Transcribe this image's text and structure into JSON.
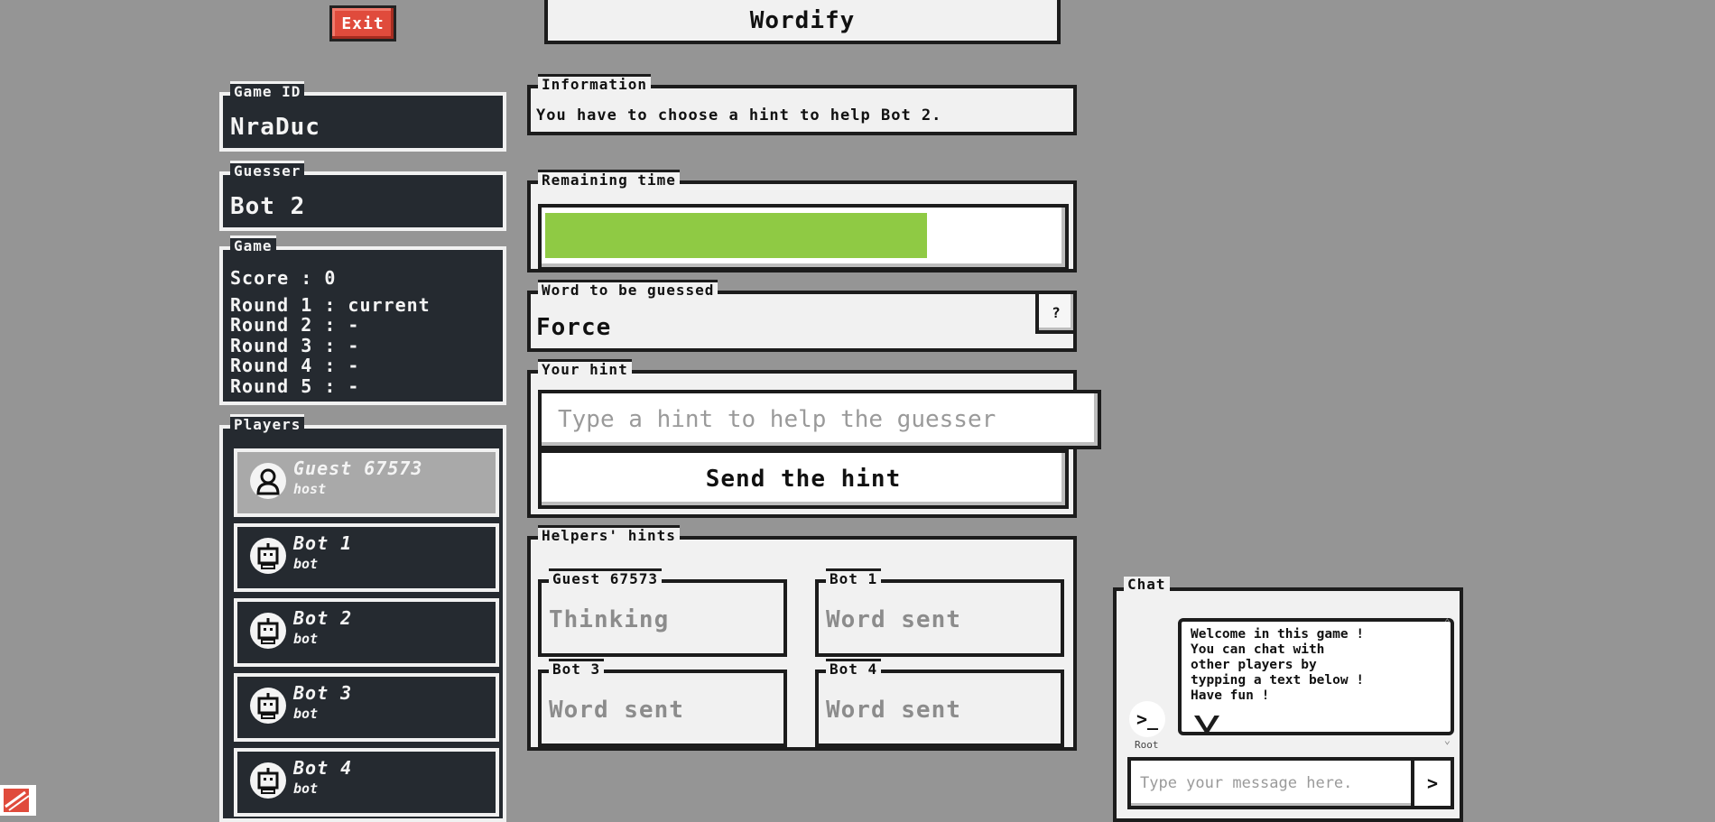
{
  "header": {
    "exit_label": "Exit",
    "title": "Wordify"
  },
  "game_id": {
    "legend": "Game ID",
    "value": "NraDuc"
  },
  "guesser": {
    "legend": "Guesser",
    "value": "Bot 2"
  },
  "game": {
    "legend": "Game",
    "score": "Score : 0",
    "rounds": [
      "Round 1 : current",
      "Round 2 : -",
      "Round 3 : -",
      "Round 4 : -",
      "Round 5 : -"
    ]
  },
  "players": {
    "legend": "Players",
    "items": [
      {
        "name": "Guest 67573",
        "role": "host",
        "icon": "user-icon"
      },
      {
        "name": "Bot 1",
        "role": "bot",
        "icon": "robot-icon"
      },
      {
        "name": "Bot 2",
        "role": "bot",
        "icon": "robot-icon"
      },
      {
        "name": "Bot 3",
        "role": "bot",
        "icon": "robot-icon"
      },
      {
        "name": "Bot 4",
        "role": "bot",
        "icon": "robot-icon"
      }
    ]
  },
  "information": {
    "legend": "Information",
    "text": "You have to choose a hint to help Bot 2."
  },
  "timer": {
    "legend": "Remaining time",
    "remaining_fraction": 0.74,
    "color": "#8fca44"
  },
  "word": {
    "legend": "Word to be guessed",
    "value": "Force",
    "help_label": "?"
  },
  "hint": {
    "legend": "Your hint",
    "placeholder": "Type a hint to help the guesser",
    "send_label": "Send the hint"
  },
  "helpers": {
    "legend": "Helpers' hints",
    "items": [
      {
        "name": "Guest 67573",
        "status": "Thinking"
      },
      {
        "name": "Bot 1",
        "status": "Word sent"
      },
      {
        "name": "Bot 3",
        "status": "Word sent"
      },
      {
        "name": "Bot 4",
        "status": "Word sent"
      }
    ]
  },
  "chat": {
    "legend": "Chat",
    "messages": [
      {
        "author": "Root",
        "avatar": ">_",
        "lines": [
          "Welcome in this game !",
          "You can chat with",
          "other players by",
          "typping a text below !",
          "Have fun !"
        ]
      }
    ],
    "placeholder": "Type your message here.",
    "send_label": ">"
  }
}
